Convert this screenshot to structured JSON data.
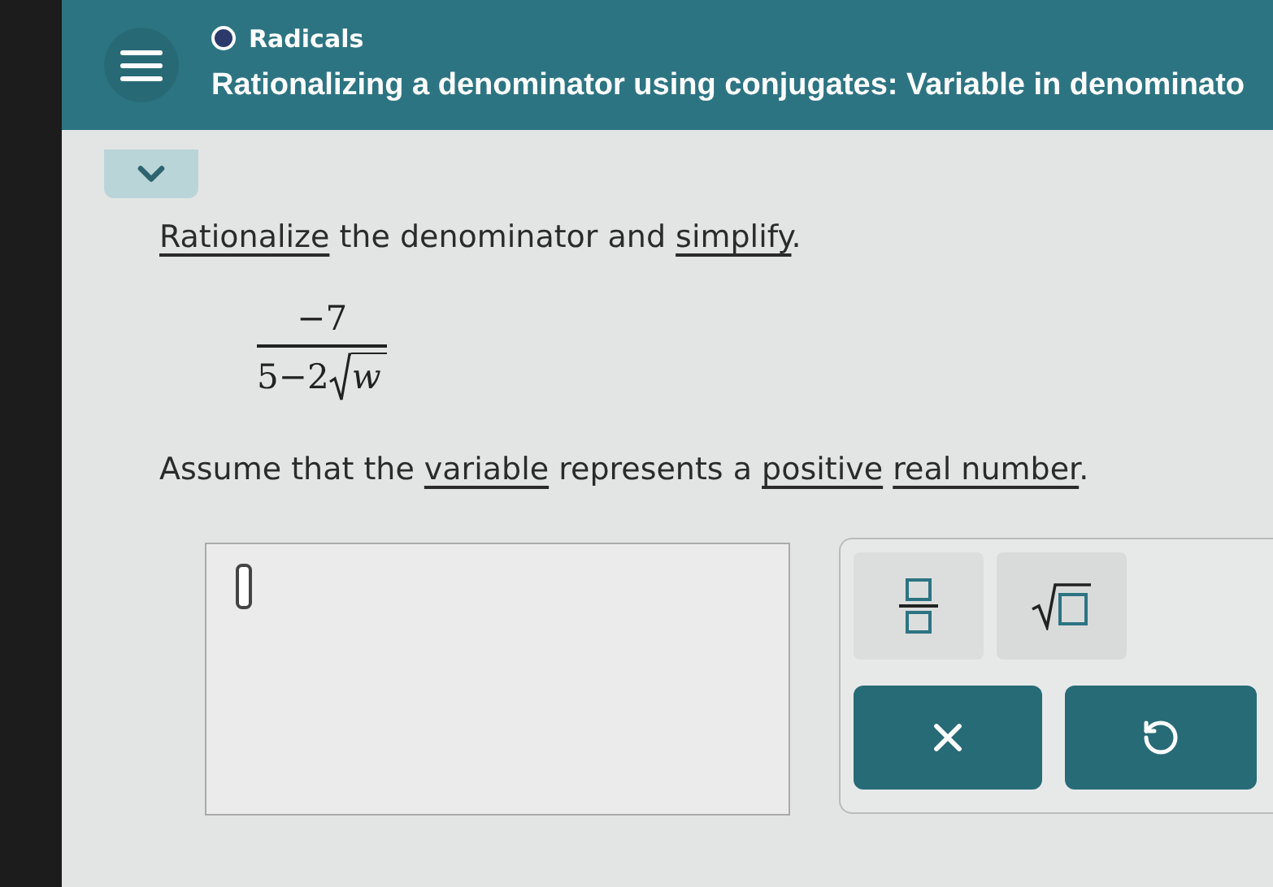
{
  "header": {
    "topic": "Radicals",
    "title": "Rationalizing a denominator using conjugates: Variable in denominato"
  },
  "instruction": [
    {
      "kind": "link",
      "text": "Rationalize"
    },
    {
      "kind": "text",
      "text": " the denominator and "
    },
    {
      "kind": "link",
      "text": "simplify"
    },
    {
      "kind": "text",
      "text": "."
    }
  ],
  "expression": {
    "numerator": "−7",
    "denominator": "5−2",
    "radicand": "w"
  },
  "assumption": [
    {
      "kind": "text",
      "text": "Assume that the "
    },
    {
      "kind": "link",
      "text": "variable"
    },
    {
      "kind": "text",
      "text": " represents a "
    },
    {
      "kind": "link",
      "text": "positive"
    },
    {
      "kind": "space"
    },
    {
      "kind": "link",
      "text": "real number"
    },
    {
      "kind": "text",
      "text": "."
    }
  ]
}
